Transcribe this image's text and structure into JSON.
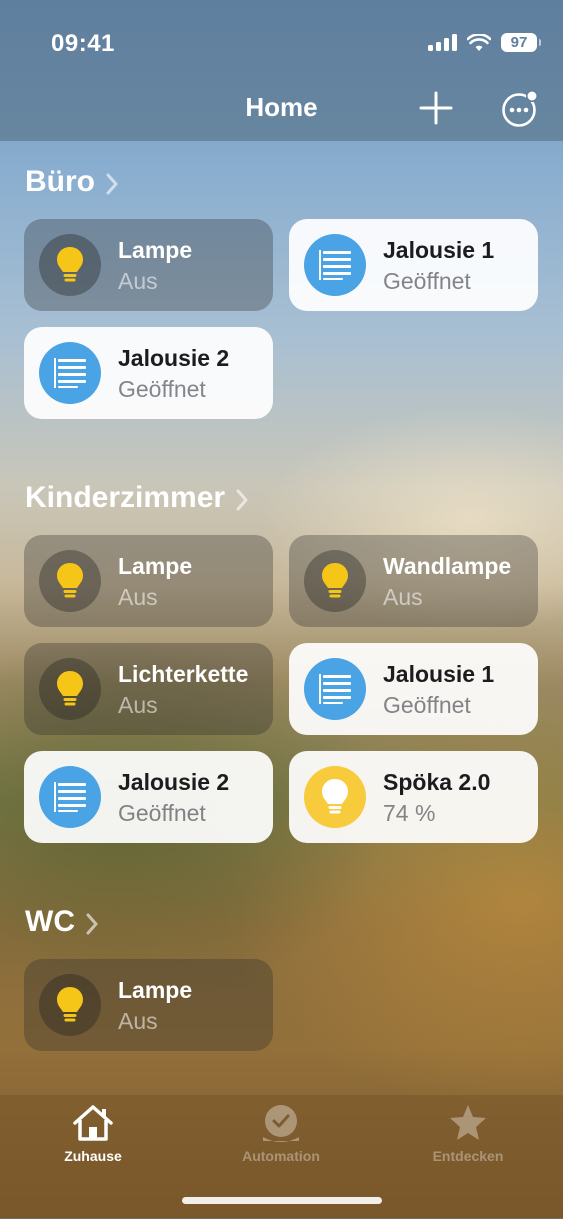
{
  "status_bar": {
    "time": "09:41",
    "battery": "97"
  },
  "nav": {
    "title": "Home",
    "add_icon": "plus-icon",
    "more_icon": "ellipsis-circle-icon"
  },
  "sections": [
    {
      "title": "Büro",
      "accessories": [
        {
          "name": "Lampe",
          "state": "Aus",
          "icon": "lightbulb-icon",
          "active": false
        },
        {
          "name": "Jalousie 1",
          "state": "Geöffnet",
          "icon": "blinds-icon",
          "active": true
        },
        {
          "name": "Jalousie 2",
          "state": "Geöffnet",
          "icon": "blinds-icon",
          "active": true
        }
      ]
    },
    {
      "title": "Kinderzimmer",
      "accessories": [
        {
          "name": "Lampe",
          "state": "Aus",
          "icon": "lightbulb-icon",
          "active": false
        },
        {
          "name": "Wandlampe",
          "state": "Aus",
          "icon": "lightbulb-icon",
          "active": false
        },
        {
          "name": "Lichterkette",
          "state": "Aus",
          "icon": "lightbulb-icon",
          "active": false
        },
        {
          "name": "Jalousie 1",
          "state": "Geöffnet",
          "icon": "blinds-icon",
          "active": true
        },
        {
          "name": "Jalousie 2",
          "state": "Geöffnet",
          "icon": "blinds-icon",
          "active": true
        },
        {
          "name": "Spöka 2.0",
          "state": "74 %",
          "icon": "lightbulb-icon",
          "active": true
        }
      ]
    },
    {
      "title": "WC",
      "accessories": [
        {
          "name": "Lampe",
          "state": "Aus",
          "icon": "lightbulb-icon",
          "active": false
        }
      ]
    }
  ],
  "tab_bar": {
    "items": [
      {
        "label": "Zuhause",
        "icon": "house-icon",
        "active": true
      },
      {
        "label": "Automation",
        "icon": "clock-house-icon",
        "active": false
      },
      {
        "label": "Entdecken",
        "icon": "star-icon",
        "active": false
      }
    ]
  },
  "colors": {
    "blinds_accent": "#4aa3e4",
    "bulb_on": "#f7cb3c",
    "bulb_off": "#f5c518"
  }
}
